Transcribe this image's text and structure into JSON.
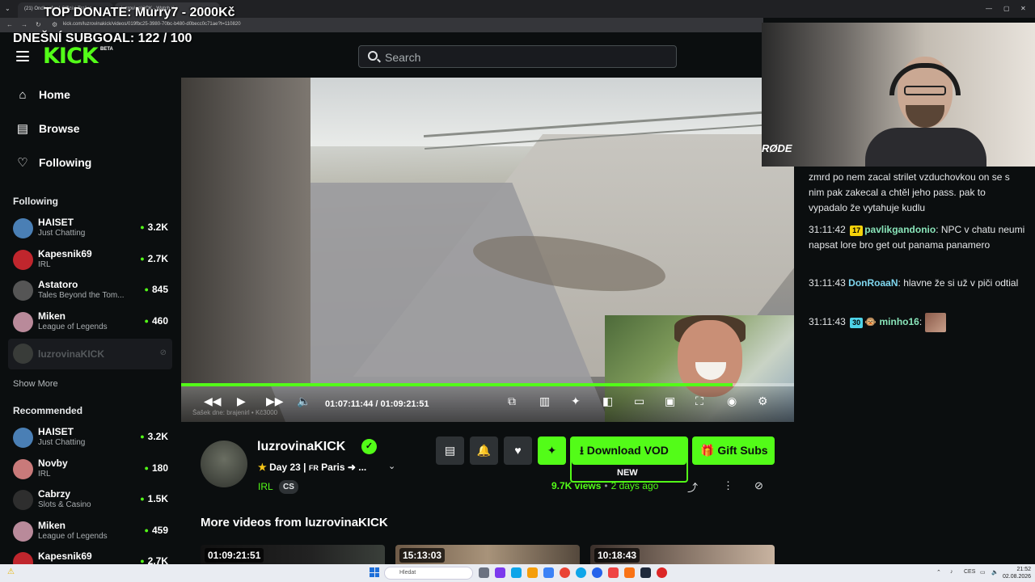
{
  "browser": {
    "tab1_title": "(21) Ondbasfyn | Official Trailer",
    "tab2_title": "luzrovinaKICK - Watch the",
    "url": "kick.com/luzrovinakick/videos/019fbc25-3980-70bc-b480-d0becc0c71ae?t=110820"
  },
  "overlay": {
    "top_donate": "TOP DONATE: Murry7 - 2000Kč",
    "subgoal": "DNEŠNÍ SUBGOAL: 122 / 100"
  },
  "header": {
    "logo": "KICK",
    "logo_badge": "BETA",
    "search_placeholder": "Search"
  },
  "sidebar": {
    "nav": [
      {
        "label": "Home",
        "icon": "home-icon"
      },
      {
        "label": "Browse",
        "icon": "browse-icon"
      },
      {
        "label": "Following",
        "icon": "heart-icon"
      }
    ],
    "following_heading": "Following",
    "following": [
      {
        "name": "HAISET",
        "category": "Just Chatting",
        "viewers": "3.2K",
        "color": "#4a7fb5"
      },
      {
        "name": "Kapesnik69",
        "category": "IRL",
        "viewers": "2.7K",
        "color": "#c0262d"
      },
      {
        "name": "Astatoro",
        "category": "Tales Beyond the Tom...",
        "viewers": "845",
        "color": "#555555"
      },
      {
        "name": "Miken",
        "category": "League of Legends",
        "viewers": "460",
        "color": "#b98a9a"
      }
    ],
    "active_channel": "luzrovinaKICK",
    "show_more": "Show More",
    "recommended_heading": "Recommended",
    "recommended": [
      {
        "name": "HAISET",
        "category": "Just Chatting",
        "viewers": "3.2K",
        "color": "#4a7fb5"
      },
      {
        "name": "Novby",
        "category": "IRL",
        "viewers": "180",
        "color": "#c97a7a"
      },
      {
        "name": "Cabrzy",
        "category": "Slots & Casino",
        "viewers": "1.5K",
        "color": "#2e2e2e"
      },
      {
        "name": "Miken",
        "category": "League of Legends",
        "viewers": "459",
        "color": "#b98a9a"
      },
      {
        "name": "Kapesnik69",
        "category": "",
        "viewers": "2.7K",
        "color": "#c0262d"
      }
    ]
  },
  "video": {
    "credit_text": "Šašek dne: brajenirl • Kč3000",
    "current_time": "01:07:11:44",
    "separator": "/",
    "duration": "01:09:21:51",
    "progress_fraction": 0.9
  },
  "webcam": {
    "mic_brand": "RØDE"
  },
  "chat": {
    "messages": [
      {
        "timestamp": "",
        "badge": "",
        "username": "",
        "text": "zmrd po nem zacal strilet vzduchovkou on se s nim pak zakecal a chtěl jeho pass. pak to vypadalo že vytahuje kudlu"
      },
      {
        "timestamp": "31:11:42",
        "badge": "17",
        "username": "pavlikgandonio",
        "text": "NPC v chatu neumi napsat lore bro get out panama panamero"
      },
      {
        "timestamp": "31:11:43",
        "badge": "",
        "username": "DonRoaaN",
        "text": "hlavne že si už v piči odtial"
      },
      {
        "timestamp": "31:11:43",
        "badge": "30",
        "username": "minho16",
        "text": ""
      }
    ]
  },
  "channel": {
    "name": "luzrovinaKICK",
    "title_prefix": "Day 23 | ",
    "title_flag": "FR",
    "title_rest": " Paris ➜ ...",
    "category": "IRL",
    "language": "CS",
    "views": "9.7K views",
    "separator": "•",
    "posted": "2 days ago"
  },
  "actions": {
    "download_label": "Download VOD",
    "download_badge": "NEW",
    "gift_label": "Gift Subs"
  },
  "more_videos": {
    "heading": "More videos from luzrovinaKICK",
    "items": [
      {
        "duration": "01:09:21:51"
      },
      {
        "duration": "15:13:03"
      },
      {
        "duration": "10:18:43"
      }
    ]
  },
  "taskbar": {
    "search_placeholder": "Hledat",
    "language": "CES",
    "time": "21:52",
    "date": "02.08.2026"
  }
}
